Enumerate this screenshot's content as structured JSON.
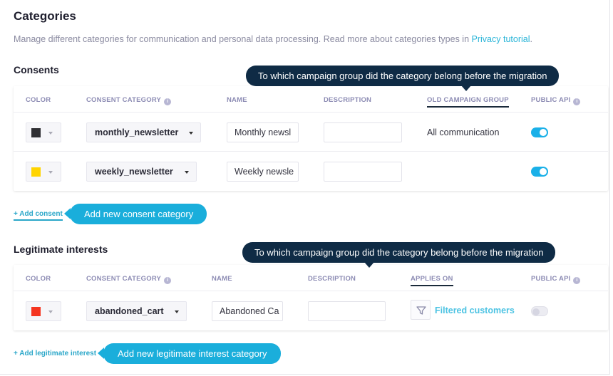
{
  "page": {
    "title": "Categories",
    "description": "Manage different categories for communication and personal data processing. Read more about categories types in ",
    "tutorial_link": "Privacy tutorial",
    "description_end": "."
  },
  "consents": {
    "title": "Consents",
    "columns": {
      "color": "COLOR",
      "category": "CONSENT CATEGORY",
      "name": "NAME",
      "description": "DESCRIPTION",
      "old_group": "OLD CAMPAIGN GROUP",
      "public_api": "PUBLIC API"
    },
    "rows": [
      {
        "color": "#2f2f33",
        "category": "monthly_newsletter",
        "name": "Monthly newsl",
        "description": "",
        "old_group": "All communication",
        "public_api": true
      },
      {
        "color": "#ffd400",
        "category": "weekly_newsletter",
        "name": "Weekly newsle",
        "description": "",
        "old_group": "",
        "public_api": true
      }
    ],
    "add_label": "+ Add consent",
    "tooltip": "To which campaign group did the category belong before the migration",
    "callout": "Add new consent category"
  },
  "legitimate": {
    "title": "Legitimate interests",
    "columns": {
      "color": "COLOR",
      "category": "CONSENT CATEGORY",
      "name": "NAME",
      "description": "DESCRIPTION",
      "applies_on": "APPLIES ON",
      "public_api": "PUBLIC API"
    },
    "rows": [
      {
        "color": "#f53520",
        "category": "abandoned_cart",
        "name": "Abandoned Ca",
        "description": "",
        "applies_on": "Filtered customers",
        "public_api": false
      }
    ],
    "add_label": "+ Add legitimate interest",
    "tooltip": "To which campaign group did the category belong before the migration",
    "callout": "Add new legitimate interest category"
  },
  "icons": {
    "info": "i",
    "filter": "filter-icon",
    "caret": "caret-down-icon"
  }
}
